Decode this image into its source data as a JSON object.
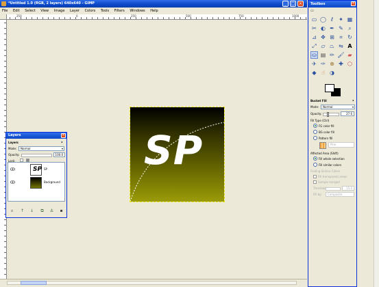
{
  "main_window": {
    "title": "*Untitled 1.0 (RGB, 2 layers) 640x640 - GIMP",
    "menu": [
      "File",
      "Edit",
      "Select",
      "View",
      "Image",
      "Layer",
      "Colors",
      "Tools",
      "Filters",
      "Windows",
      "Help"
    ],
    "ruler_labels": [
      "250",
      "0",
      "250",
      "500",
      "750",
      "1000"
    ],
    "canvas_text": "SP",
    "colors": {
      "titlebar": "#0a48c6",
      "gradient_top": "#000000",
      "gradient_bottom": "#9b9b08"
    }
  },
  "layers_dialog": {
    "title": "Layers",
    "tab_label": "Layers",
    "mode_label": "Mode:",
    "mode_value": "Normal",
    "opacity_label": "Opacity:",
    "opacity_value": "100.0",
    "lock_label": "Lock:",
    "layers": [
      {
        "name": "SP",
        "visible": true
      },
      {
        "name": "Background",
        "visible": true
      }
    ],
    "bottom_buttons": [
      "new-layer",
      "raise-layer",
      "lower-layer",
      "duplicate-layer",
      "anchor-layer",
      "delete-layer"
    ]
  },
  "toolbox": {
    "title": "Toolbox",
    "tools": [
      "rect-select",
      "ellipse-select",
      "free-select",
      "fuzzy-select",
      "select-by-color",
      "scissors",
      "foreground-select",
      "paths",
      "color-picker",
      "zoom",
      "measure",
      "move",
      "align",
      "crop",
      "rotate",
      "scale",
      "shear",
      "perspective",
      "flip",
      "text",
      "bucket-fill",
      "blend",
      "pencil",
      "paintbrush",
      "eraser",
      "airbrush",
      "ink",
      "clone",
      "heal",
      "perspective-clone",
      "convolve",
      "smudge",
      "dodge-burn"
    ],
    "active_tool": "bucket-fill",
    "options": {
      "title": "Bucket Fill",
      "mode_label": "Mode:",
      "mode_value": "Normal",
      "opacity_label": "Opacity:",
      "opacity_value": "27.6",
      "opacity_fraction": 0.276,
      "fill_type_label": "Fill Type (Ctrl)",
      "fill_types": [
        "FG color fill",
        "BG color fill",
        "Pattern fill"
      ],
      "fill_type_selected": 0,
      "pattern_name": "Pine",
      "affected_area_label": "Affected Area (Shift)",
      "affected_areas": [
        "Fill whole selection",
        "Fill similar colors"
      ],
      "affected_area_selected": 0,
      "finding_similar_label": "Finding Similar Colors",
      "fill_transparent_label": "Fill transparent areas",
      "sample_merged_label": "Sample merged",
      "threshold_label": "Threshold:",
      "threshold_value": "15.0",
      "fill_by_label": "Fill by:",
      "fill_by_value": "Composite"
    }
  }
}
